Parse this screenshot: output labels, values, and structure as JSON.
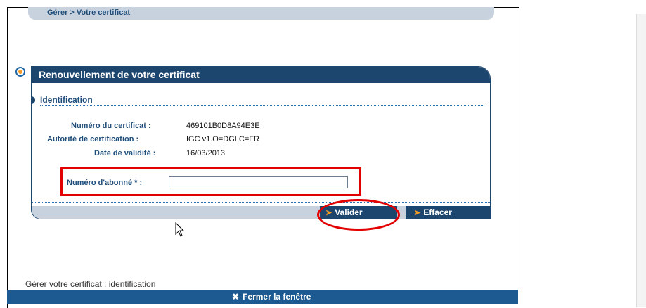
{
  "breadcrumb": "Gérer > Votre certificat",
  "panel": {
    "title": "Renouvellement de votre certificat",
    "section_title": "Identification",
    "rows": [
      {
        "label": "Numéro du certificat :",
        "value": "469101B0D8A94E3E"
      },
      {
        "label": "Autorité de certification :",
        "value": "IGC v1.O=DGI.C=FR"
      },
      {
        "label": "Date de validité :",
        "value": "16/03/2013"
      }
    ],
    "subscriber_label": "Numéro d'abonné * :",
    "subscriber_value": ""
  },
  "buttons": {
    "validate": "Valider",
    "clear": "Effacer"
  },
  "status_text": "Gérer votre certificat : identification",
  "close_bar": {
    "label": "Fermer la fenêtre"
  },
  "colors": {
    "header_blue": "#1d466f",
    "label_blue": "#1f4d7a",
    "light_band": "#c7d2de",
    "accent_orange": "#f39b22",
    "highlight_red": "#e20000"
  },
  "icons": [
    "info-bullet-icon",
    "chevron-right-icon",
    "close-icon",
    "mouse-pointer-icon"
  ]
}
